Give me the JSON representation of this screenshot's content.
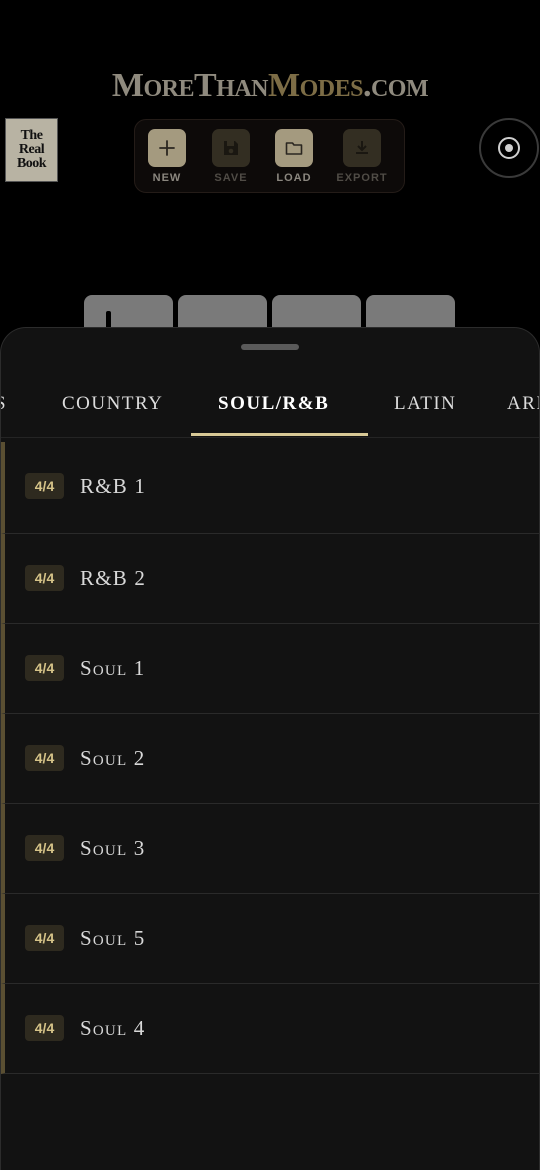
{
  "header": {
    "logo_part1": "MoreThan",
    "logo_part2": "Modes",
    "logo_part3": ".com",
    "thumbnail_text": [
      "The",
      "Real",
      "Book"
    ]
  },
  "toolbar": {
    "buttons": [
      {
        "label": "NEW",
        "icon": "plus-icon",
        "enabled": true
      },
      {
        "label": "SAVE",
        "icon": "floppy-icon",
        "enabled": false
      },
      {
        "label": "LOAD",
        "icon": "folder-icon",
        "enabled": true
      },
      {
        "label": "EXPORT",
        "icon": "download-icon",
        "enabled": false
      }
    ]
  },
  "settings": {
    "icon": "target-icon"
  },
  "sheet": {
    "tabs": [
      {
        "label": "S",
        "active": false
      },
      {
        "label": "COUNTRY",
        "active": false
      },
      {
        "label": "SOUL/R&B",
        "active": true
      },
      {
        "label": "LATIN",
        "active": false
      },
      {
        "label": "ARI",
        "active": false
      }
    ],
    "items": [
      {
        "meter": "4/4",
        "name": "R&B 1"
      },
      {
        "meter": "4/4",
        "name": "R&B 2"
      },
      {
        "meter": "4/4",
        "name": "Soul 1"
      },
      {
        "meter": "4/4",
        "name": "Soul 2"
      },
      {
        "meter": "4/4",
        "name": "Soul 3"
      },
      {
        "meter": "4/4",
        "name": "Soul 5"
      },
      {
        "meter": "4/4",
        "name": "Soul 4"
      }
    ]
  },
  "colors": {
    "accent": "#d8c996",
    "badge_text": "#d6c489",
    "sheet_bg": "#121212"
  }
}
